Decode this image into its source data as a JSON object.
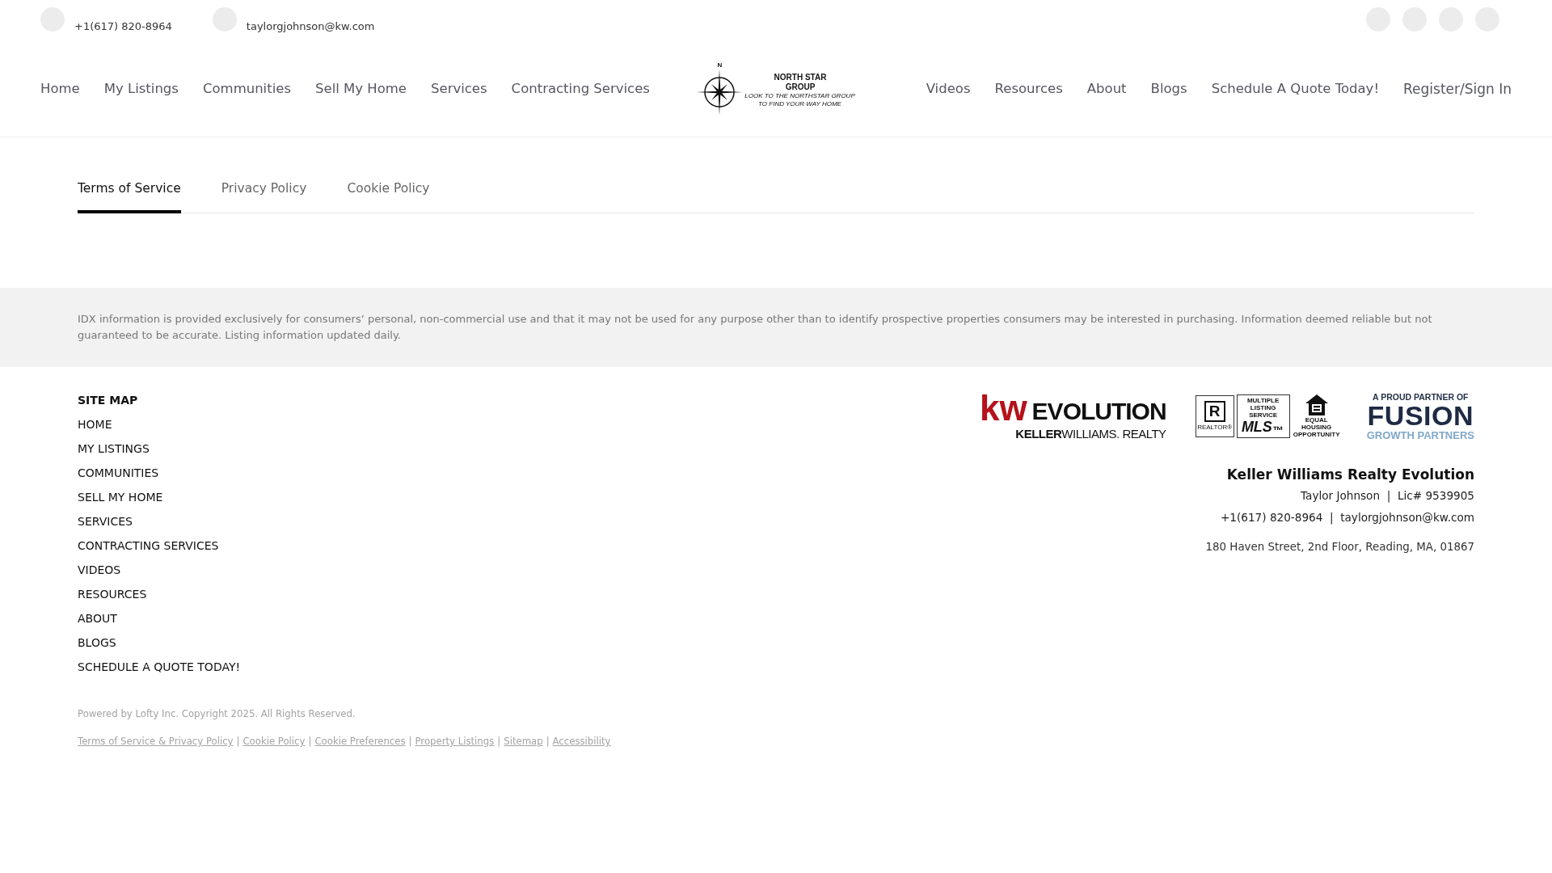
{
  "top_bar": {
    "contacts": [
      "+1(617) 820-8964",
      "taylorgjohnson@kw.com"
    ]
  },
  "header": {
    "nav_left": [
      "Home",
      "My Listings",
      "Communities",
      "Sell My Home",
      "Services",
      "Contracting Services"
    ],
    "logo": {
      "mark": "N",
      "name": "NORTH STAR",
      "name_2": "GROUP",
      "tagline": [
        "LOOK TO THE NORTHSTAR GROUP",
        "TO FIND YOUR WAY HOME"
      ]
    },
    "nav_right": [
      "Videos",
      "Resources",
      "About",
      "Blogs",
      "Schedule A Quote Today!"
    ],
    "account_link": "Register/Sign In"
  },
  "policy_tabs": [
    {
      "label": "Terms of Service",
      "selected": true
    },
    {
      "label": "Privacy Policy",
      "selected": false
    },
    {
      "label": "Cookie Policy",
      "selected": false
    }
  ],
  "idx_notice": "IDX information is provided exclusively for consumers’ personal, non-commercial use and that it may not be used for any purpose other than to identify prospective properties consumers may be interested in purchasing. Information deemed reliable but not guaranteed to be accurate. Listing information updated daily.",
  "footer": {
    "site_map": {
      "title": "SITE MAP",
      "links": [
        "HOME",
        "MY LISTINGS",
        "COMMUNITIES",
        "SELL MY HOME",
        "SERVICES",
        "CONTRACTING SERVICES",
        "VIDEOS",
        "RESOURCES",
        "ABOUT",
        "BLOGS",
        "SCHEDULE A QUOTE TODAY!"
      ]
    },
    "partner_logos": [
      {
        "kind": "kw",
        "mark": "kw",
        "name": "EVOLUTION",
        "subline": "**KELLER**WILLIAMS. REALTY"
      },
      {
        "kind": "mls",
        "realtor_mark": "R",
        "realtor_label": "REALTOR®",
        "mls_caption": "MULTIPLE LISTING SERVICE",
        "mls_mark": "MLS$_{™}$",
        "housing_caption": "EQUAL HOUSING OPPORTUNITY"
      },
      {
        "kind": "fusion",
        "kicker": "A PROUD PARTNER OF",
        "name": "FUSION",
        "subline": "GROWTH PARTNERS"
      }
    ],
    "brokerage": {
      "name": "Keller Williams Realty Evolution",
      "lines": [
        "Taylor Johnson  |  Lic# 9539905",
        "+1(617) 820-8964  |  taylorgjohnson@kw.com"
      ],
      "address": "180 Haven Street, 2nd Floor, Reading, MA, 01867"
    },
    "powered_by": {
      "prefix": "Powered by",
      "link": "Lofty Inc.",
      "suffix": "Copyright 2025. All Rights Reserved."
    },
    "legal_links": [
      "Terms of Service & Privacy Policy",
      "Cookie Policy",
      "Cookie Preferences",
      "Property Listings",
      "Sitemap",
      "Accessibility"
    ],
    "legal_separator": "|"
  }
}
